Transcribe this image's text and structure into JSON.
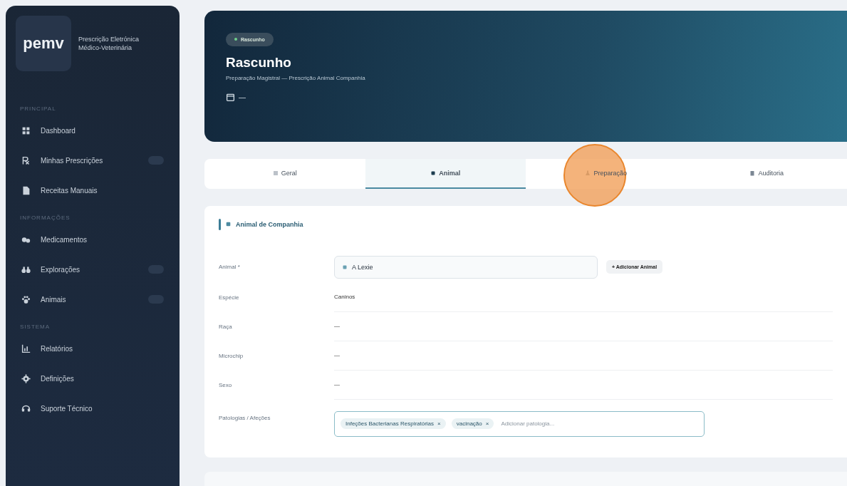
{
  "sidebar": {
    "logo": "pemv",
    "app_name": "Prescrição Eletrónica Médico-Veterinária",
    "sections": [
      {
        "label": "PRINCIPAL",
        "items": [
          {
            "label": "Dashboard",
            "badge": false
          },
          {
            "label": "Minhas Prescrições",
            "badge": true
          },
          {
            "label": "Receitas Manuais",
            "badge": false
          }
        ]
      },
      {
        "label": "INFORMAÇÕES",
        "items": [
          {
            "label": "Medicamentos",
            "badge": false
          },
          {
            "label": "Explorações",
            "badge": true
          },
          {
            "label": "Animais",
            "badge": true
          }
        ]
      },
      {
        "label": "SISTEMA",
        "items": [
          {
            "label": "Relatórios",
            "badge": false
          },
          {
            "label": "Definições",
            "badge": false
          },
          {
            "label": "Suporte Técnico",
            "badge": false
          }
        ]
      }
    ]
  },
  "header": {
    "status_badge": "Rascunho",
    "title": "Rascunho",
    "subtitle": "Preparação Magistral — Prescrição Animal Companhia",
    "date": "—"
  },
  "tabs": [
    {
      "label": "Geral",
      "selected": false
    },
    {
      "label": "Animal",
      "selected": true
    },
    {
      "label": "Preparação",
      "selected": false
    },
    {
      "label": "Auditoria",
      "selected": false
    }
  ],
  "section": {
    "title": "Animal de Companhia",
    "animal_field": {
      "label": "Animal *",
      "value": "A Lexie",
      "button": "+ Adicionar Animal"
    },
    "rows": [
      {
        "label": "Espécie",
        "value": "Caninos"
      },
      {
        "label": "Raça",
        "value": "—"
      },
      {
        "label": "Microchip",
        "value": "—"
      },
      {
        "label": "Sexo",
        "value": "—"
      }
    ],
    "pathologies": {
      "label": "Patologias / Afeções",
      "tags": [
        {
          "label": "Infeções Bacterianas Respiratórias",
          "remove": "×"
        },
        {
          "label": "vacinação",
          "remove": "×"
        }
      ],
      "placeholder": "Adicionar patologia..."
    }
  }
}
